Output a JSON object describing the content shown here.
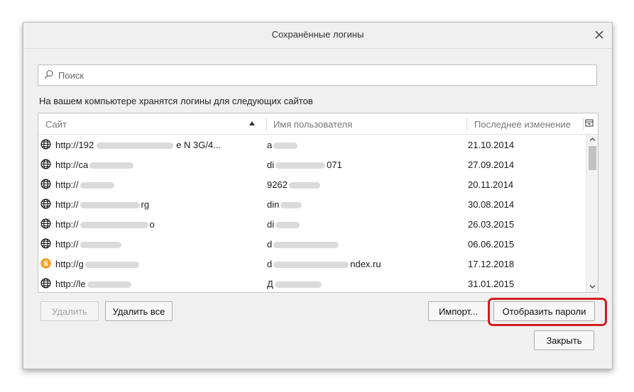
{
  "dialog": {
    "title": "Сохранённые логины",
    "close_icon": "close-icon"
  },
  "search": {
    "placeholder": "Поиск",
    "value": "",
    "icon": "search-icon"
  },
  "description": "На вашем компьютере хранятся логины для следующих сайтов",
  "table": {
    "columns": [
      "Сайт",
      "Имя пользователя",
      "Последнее изменение"
    ],
    "sort": {
      "column": "Сайт",
      "direction": "ascending"
    },
    "rows": [
      {
        "site": "http://192",
        "site_tail": "e N 3G/4...",
        "user": "a",
        "user_tail": "",
        "date": "21.10.2014",
        "icon": "globe-icon"
      },
      {
        "site": "http://ca",
        "site_tail": "",
        "user": "di",
        "user_tail": "071",
        "date": "27.09.2014",
        "icon": "globe-icon"
      },
      {
        "site": "http://",
        "site_tail": "",
        "user": "9262",
        "user_tail": "",
        "date": "20.11.2014",
        "icon": "globe-icon"
      },
      {
        "site": "http://",
        "site_tail": "rg",
        "user": "din",
        "user_tail": "",
        "date": "30.08.2014",
        "icon": "globe-icon"
      },
      {
        "site": "http://",
        "site_tail": "o",
        "user": "di",
        "user_tail": "",
        "date": "26.03.2015",
        "icon": "globe-icon"
      },
      {
        "site": "http://",
        "site_tail": "",
        "user": "d",
        "user_tail": "",
        "date": "06.06.2015",
        "icon": "globe-icon"
      },
      {
        "site": "http://g",
        "site_tail": "",
        "user": "d",
        "user_tail": "ndex.ru",
        "date": "17.12.2018",
        "icon": "yandex-icon"
      },
      {
        "site": "http://le",
        "site_tail": "",
        "user": "Д",
        "user_tail": "",
        "date": "31.01.2015",
        "icon": "globe-icon"
      }
    ]
  },
  "buttons": {
    "delete": "Удалить",
    "delete_all": "Удалить все",
    "import": "Импорт...",
    "show_passwords": "Отобразить пароли",
    "close": "Закрыть"
  },
  "colors": {
    "highlight": "#d21d22",
    "yandex_icon": "#f5a623"
  }
}
